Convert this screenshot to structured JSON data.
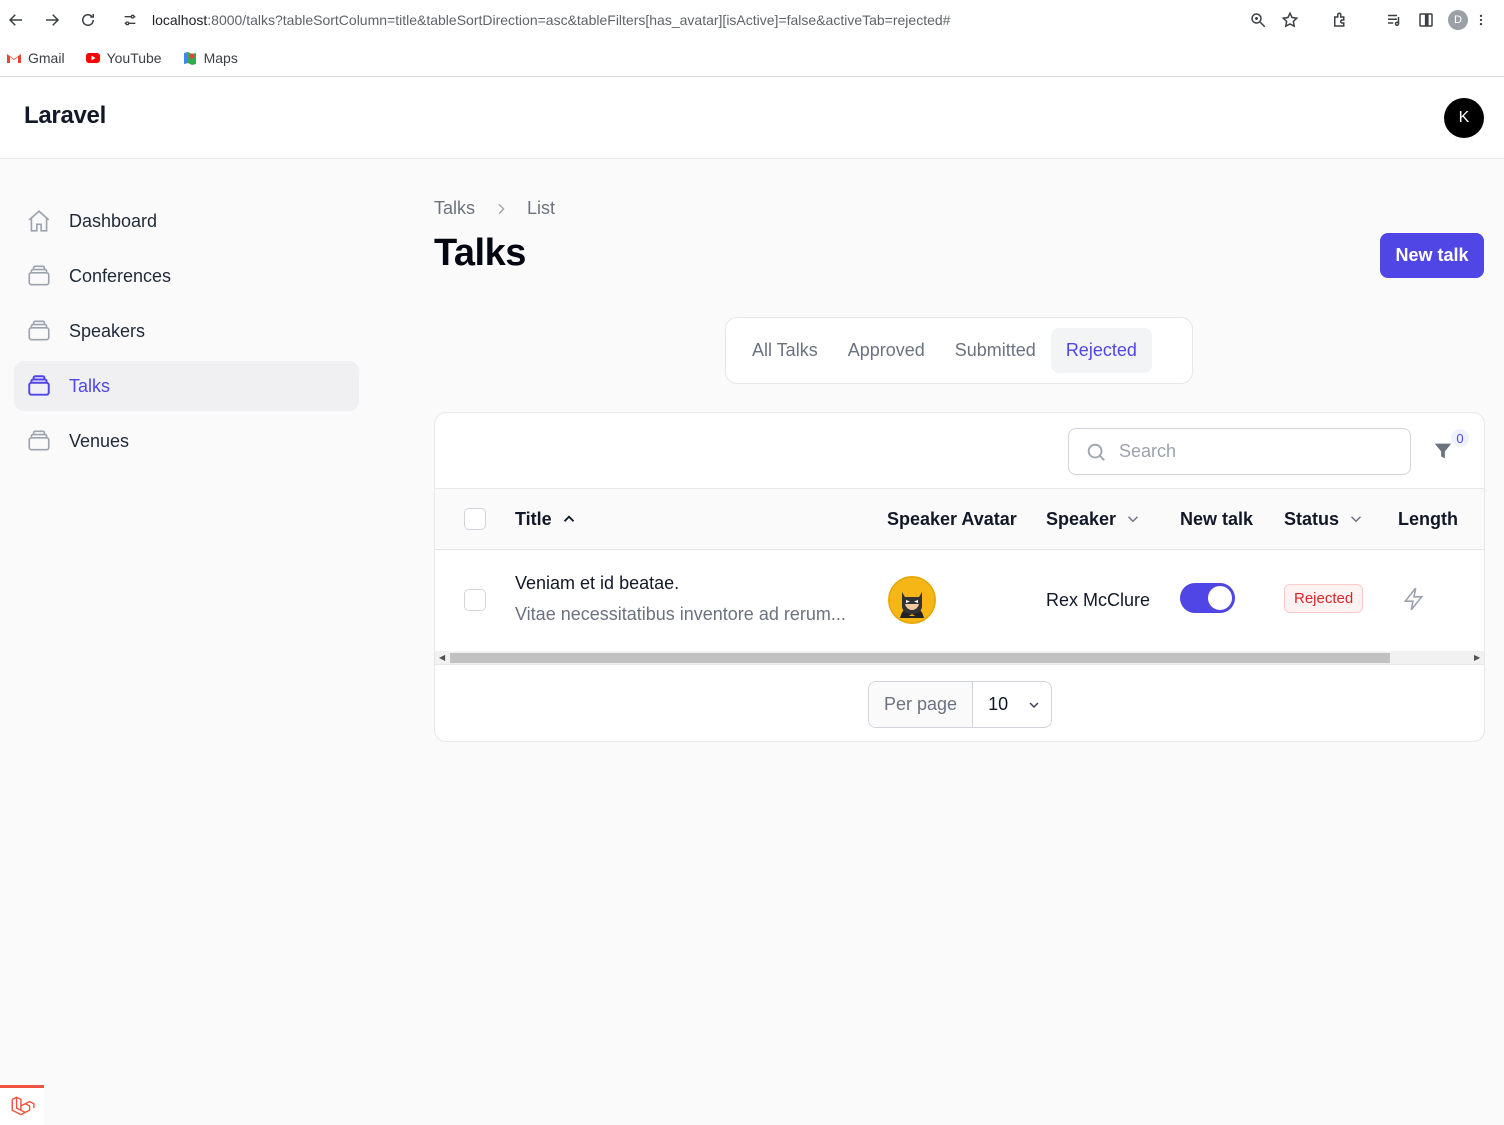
{
  "browser": {
    "url_host": "localhost",
    "url_rest": ":8000/talks?tableSortColumn=title&tableSortDirection=asc&tableFilters[has_avatar][isActive]=false&activeTab=rejected#",
    "profile_initial": "D",
    "bookmarks": [
      {
        "label": "Gmail",
        "icon": "gmail-icon"
      },
      {
        "label": "YouTube",
        "icon": "youtube-icon"
      },
      {
        "label": "Maps",
        "icon": "maps-icon"
      }
    ]
  },
  "header": {
    "brand": "Laravel",
    "user_initial": "K"
  },
  "sidebar": {
    "items": [
      {
        "label": "Dashboard",
        "icon": "home-icon",
        "active": false
      },
      {
        "label": "Conferences",
        "icon": "collection-icon",
        "active": false
      },
      {
        "label": "Speakers",
        "icon": "collection-icon",
        "active": false
      },
      {
        "label": "Talks",
        "icon": "collection-icon",
        "active": true
      },
      {
        "label": "Venues",
        "icon": "collection-icon",
        "active": false
      }
    ]
  },
  "page": {
    "breadcrumb": [
      "Talks",
      "List"
    ],
    "title": "Talks",
    "new_button": "New talk"
  },
  "tabs": [
    {
      "label": "All Talks",
      "active": false
    },
    {
      "label": "Approved",
      "active": false
    },
    {
      "label": "Submitted",
      "active": false
    },
    {
      "label": "Rejected",
      "active": true
    }
  ],
  "table": {
    "search_placeholder": "Search",
    "filter_count": "0",
    "columns": {
      "title": "Title",
      "speaker_avatar": "Speaker Avatar",
      "speaker": "Speaker",
      "new_talk": "New talk",
      "status": "Status",
      "length": "Length"
    },
    "rows": [
      {
        "title": "Veniam et id beatae.",
        "abstract": "Vitae necessitatibus inventore ad rerum...",
        "speaker": "Rex McClure",
        "new_talk": true,
        "status": "Rejected",
        "length_icon": "lightning-icon"
      }
    ],
    "per_page_label": "Per page",
    "per_page_value": "10"
  },
  "colors": {
    "primary": "#4f46e5",
    "danger": "#dc2626"
  }
}
